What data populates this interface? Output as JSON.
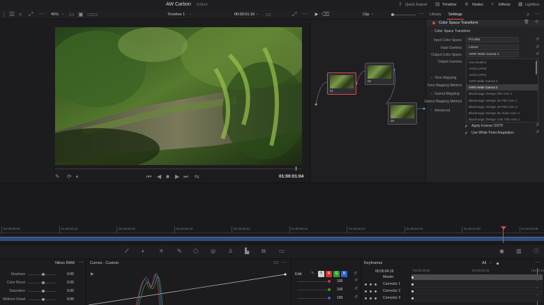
{
  "titlebar": {
    "project": "AW Carbon",
    "status": "Edited",
    "quick_export": "Quick Export",
    "timeline": "Timeline",
    "nodes": "Nodes",
    "effects": "Effects",
    "lightbox": "Lightbox"
  },
  "toolbar": {
    "zoom": "45%",
    "timeline_name": "Timeline 1",
    "timecode": "00:00:01:16",
    "clip": "Clip"
  },
  "inspector": {
    "tab_library": "Library",
    "tab_settings": "Settings",
    "effect_title": "Color Space Transform",
    "section_title": "Color Space Transform",
    "input_color_space_label": "Input Color Space",
    "input_color_space_value": "P3-D60",
    "input_gamma_label": "Input Gamma",
    "input_gamma_value": "Linear",
    "output_color_space_label": "Output Color Space",
    "output_color_space_value": "ARRI Wide Gamut 4",
    "output_gamma_label": "Output Gamma",
    "tone_mapping_label": "Tone Mapping",
    "tone_mapping_method_label": "Tone Mapping Method",
    "gamut_mapping_label": "Gamut Mapping",
    "gamut_mapping_method_label": "Gamut Mapping Method",
    "advanced_label": "Advanced",
    "apply_inverse_ootf": "Apply Inverse OOTF",
    "use_white_point": "Use White Point Adaptation",
    "dropdown_options": [
      "Use timeline",
      "ACES (AP0)",
      "ACES (AP1)",
      "ARRI Wide Gamut 3",
      "ARRI Wide Gamut 4",
      "Blackmagic Design Film Gen 1",
      "Blackmagic Design 4K Film Gen 1",
      "Blackmagic Design 4K Film Gen 3",
      "Blackmagic Design 4K Video Gen 3",
      "Blackmagic Design 4.6K Film Gen 1"
    ],
    "dropdown_selected": "ARRI Wide Gamut 4"
  },
  "viewer": {
    "timecode": "01:00:01:04"
  },
  "nodes": [
    {
      "label": "01"
    },
    {
      "label": "02"
    },
    {
      "label": "03"
    }
  ],
  "timeline": {
    "ruler": [
      "01:00:00:00",
      "01:00:00:12",
      "01:00:00:15",
      "01:00:00:18",
      "01:00:00:21",
      "01:00:00:24",
      "01:00:00:27",
      "01:00:01:03",
      "01:00:01:03",
      "01:00:01:06"
    ]
  },
  "raw_panel": {
    "title": "Nikon RAW",
    "rows": [
      {
        "label": "Shadows",
        "value": "0.00"
      },
      {
        "label": "Color Boost",
        "value": "0.00"
      },
      {
        "label": "Saturation",
        "value": "0.00"
      },
      {
        "label": "Midtone Detail",
        "value": "0.00"
      }
    ]
  },
  "curves_panel": {
    "title": "Curves - Custom",
    "edit": "Edit",
    "values": [
      "100",
      "100",
      "100"
    ]
  },
  "keyframes": {
    "title": "Keyframes",
    "filter": "All",
    "timecode": "00:00:04:16",
    "ruler": [
      "00:00:00:00",
      "00:00:02:03",
      "00:00:04:16"
    ],
    "rows": [
      "Master",
      "Corrector 1",
      "Corrector 2",
      "Corrector 3"
    ]
  },
  "colors": {
    "accent_red": "#e0454b",
    "background": "#1a1a1c",
    "panel": "#232326"
  }
}
